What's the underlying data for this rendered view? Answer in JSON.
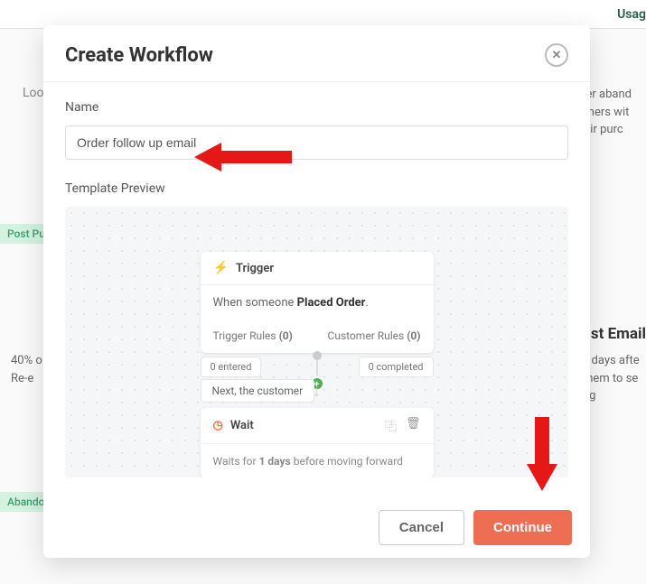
{
  "background": {
    "usage_nav": "Usag",
    "left_snippet": "Loo",
    "right_snippet": "over aband tomers wit their purc",
    "tag_post_purchase": "Post Purc",
    "heading_right": "st Email",
    "desc_right": "v days afte them to se ng",
    "desc_left": "40% o Re-e",
    "tag_abandoned": "Abandone"
  },
  "modal": {
    "title": "Create Workflow",
    "name_label": "Name",
    "name_value": "Order follow up email",
    "preview_label": "Template Preview",
    "trigger": {
      "header": "Trigger",
      "body_prefix": "When someone ",
      "body_action": "Placed Order",
      "trigger_rules_label": "Trigger Rules",
      "trigger_rules_count": "(0)",
      "customer_rules_label": "Customer Rules",
      "customer_rules_count": "(0)",
      "entered": "0 entered",
      "completed": "0 completed"
    },
    "next_label": "Next, the customer",
    "wait": {
      "header": "Wait",
      "body_prefix": "Waits for ",
      "body_duration": "1 days",
      "body_suffix": " before moving forward"
    },
    "cancel": "Cancel",
    "continue": "Continue"
  }
}
